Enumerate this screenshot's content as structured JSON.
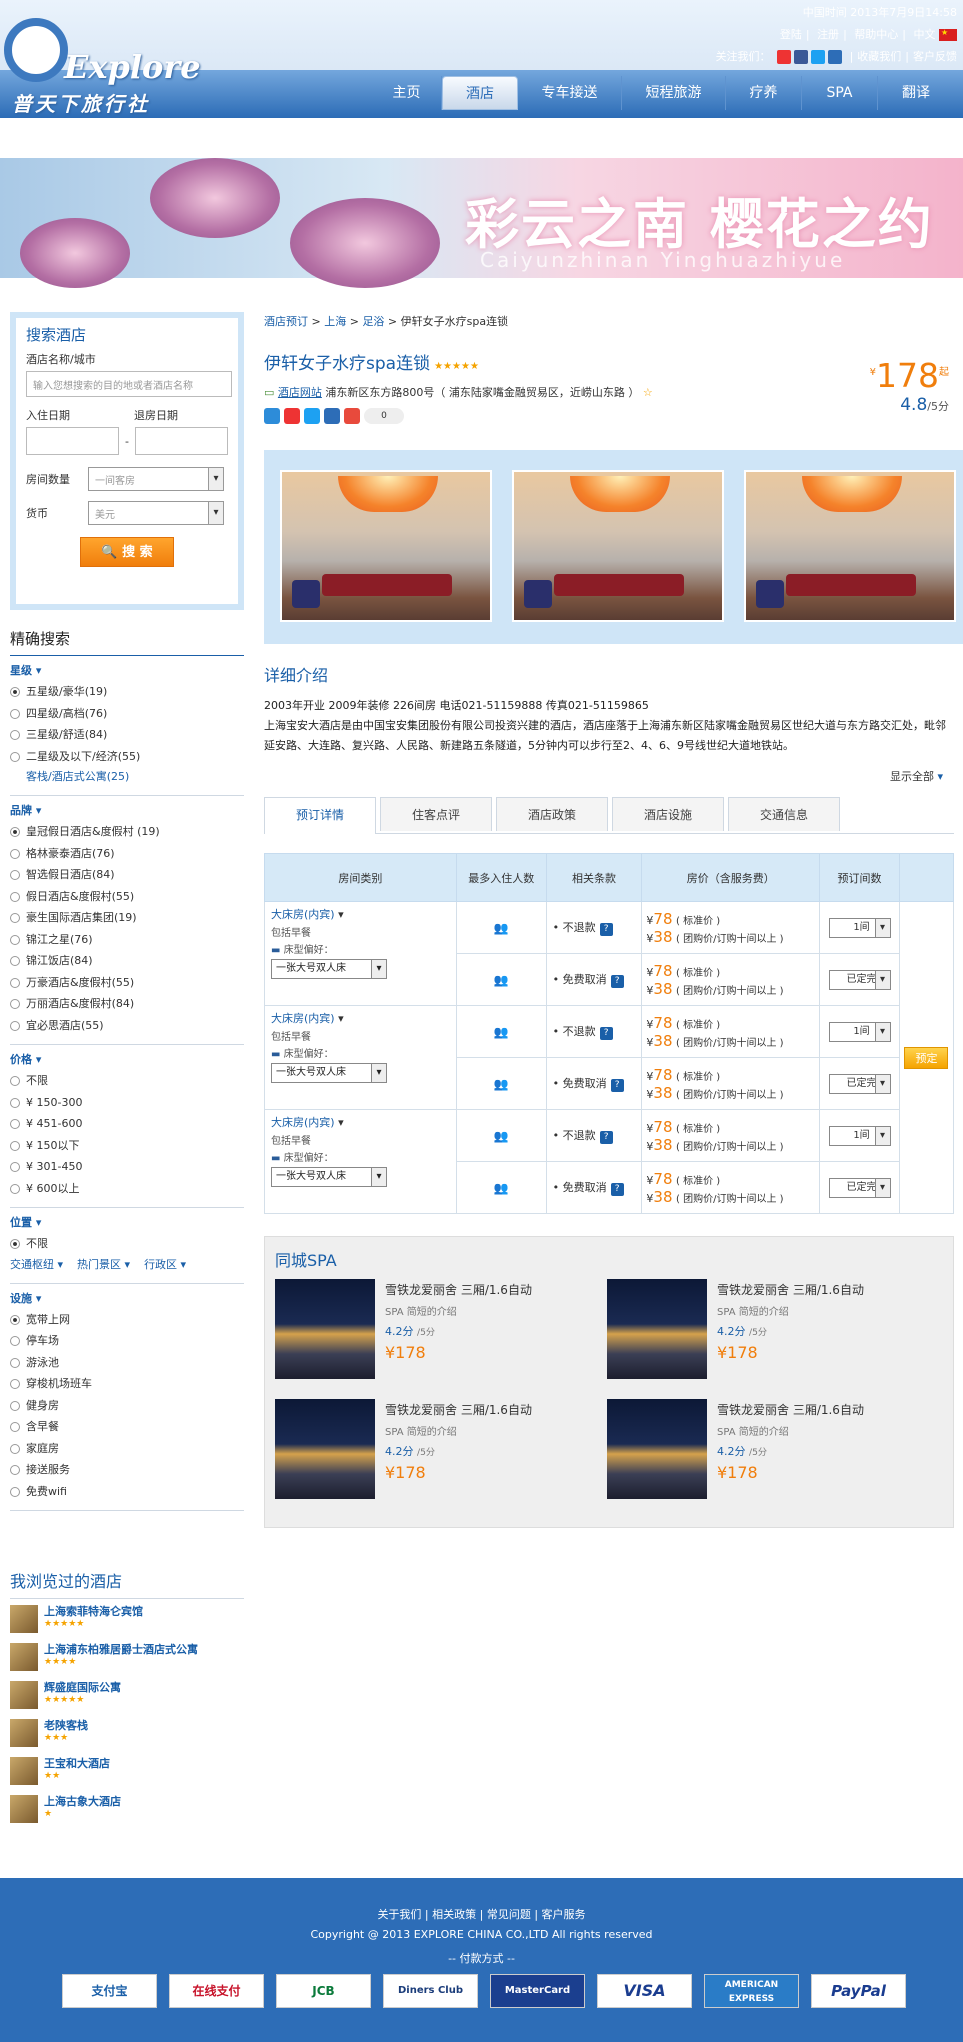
{
  "header": {
    "time_label": "中国时间",
    "time_value": "2013年7月9日14:58",
    "links": [
      "登陆",
      "注册",
      "帮助中心",
      "中文"
    ],
    "follow_label": "关注我们：",
    "fav": "收藏我们",
    "feedback": "客户反馈",
    "brand": "Explore",
    "brand_cn": "普天下旅行社",
    "nav": [
      "主页",
      "酒店",
      "专车接送",
      "短程旅游",
      "疗养",
      "SPA",
      "翻译"
    ],
    "nav_active": "酒店"
  },
  "banner": {
    "main": "彩云之南",
    "sub": "樱花之约",
    "pinyin": "Caiyunzhinan  Yinghuazhiyue"
  },
  "search": {
    "title": "搜索酒店",
    "name_label": "酒店名称/城市",
    "name_placeholder": "输入您想搜索的目的地或者酒店名称",
    "checkin_label": "入住日期",
    "checkout_label": "退房日期",
    "rooms_label": "房间数量",
    "rooms_value": "一间客房",
    "currency_label": "货币",
    "currency_value": "美元",
    "button": "搜 索"
  },
  "filters": {
    "title": "精确搜索",
    "star": {
      "title": "星级",
      "options": [
        "五星级/豪华(19)",
        "四星级/高档(76)",
        "三星级/舒适(84)",
        "二星级及以下/经济(55)"
      ],
      "link": "客栈/酒店式公寓(25)"
    },
    "brand": {
      "title": "品牌",
      "options": [
        "皇冠假日酒店&度假村 (19)",
        "格林豪泰酒店(76)",
        "智选假日酒店(84)",
        "假日酒店&度假村(55)",
        "豪生国际酒店集团(19)",
        "锦江之星(76)",
        "锦江饭店(84)",
        "万豪酒店&度假村(55)",
        "万丽酒店&度假村(84)",
        "宜必思酒店(55)"
      ]
    },
    "price": {
      "title": "价格",
      "options": [
        "不限",
        "¥ 150-300",
        "¥ 451-600",
        "¥ 150以下",
        "¥ 301-450",
        "¥ 600以上"
      ]
    },
    "location": {
      "title": "位置",
      "options": [
        "不限"
      ],
      "links": [
        "交通枢纽",
        "热门景区",
        "行政区"
      ]
    },
    "facility": {
      "title": "设施",
      "options": [
        "宽带上网",
        "停车场",
        "游泳池",
        "穿梭机场班车",
        "健身房",
        "含早餐",
        "家庭房",
        "接送服务",
        "免费wifi"
      ]
    }
  },
  "viewed": {
    "title": "我浏览过的酒店",
    "items": [
      {
        "name": "上海索菲特海仑宾馆",
        "stars": "★★★★★"
      },
      {
        "name": "上海浦东柏雅居爵士酒店式公寓",
        "stars": "★★★★"
      },
      {
        "name": "辉盛庭国际公寓",
        "stars": "★★★★★"
      },
      {
        "name": "老陕客栈",
        "stars": "★★★"
      },
      {
        "name": "王宝和大酒店",
        "stars": "★★"
      },
      {
        "name": "上海古象大酒店",
        "stars": "★"
      }
    ]
  },
  "breadcrumb": [
    "酒店预订",
    "上海",
    "足浴",
    "伊轩女子水疗spa连锁"
  ],
  "hotel": {
    "name": "伊轩女子水疗spa连锁",
    "stars": "★★★★★",
    "site": "酒店网站",
    "address": "浦东新区东方路800号（ 浦东陆家嘴金融贸易区，近崂山东路 ）",
    "share_count": "0",
    "price": "178",
    "price_unit": "起",
    "currency": "¥",
    "score": "4.8",
    "score_unit": "/5分"
  },
  "detail": {
    "title": "详细介绍",
    "line1": "2003年开业 2009年装修 226间房 电话021-51159888 传真021-51159865",
    "line2": "上海宝安大酒店是由中国宝安集团股份有限公司投资兴建的酒店，酒店座落于上海浦东新区陆家嘴金融贸易区世纪大道与东方路交汇处，毗邻延安路、大连路、复兴路、人民路、新建路五条隧道，5分钟内可以步行至2、4、6、9号线世纪大道地铁站。",
    "showall": "显示全部"
  },
  "tabs": [
    "预订详情",
    "住客点评",
    "酒店政策",
    "酒店设施",
    "交通信息"
  ],
  "table": {
    "headers": [
      "房间类别",
      "最多入住人数",
      "相关条款",
      "房价（含服务费）",
      "预订间数"
    ],
    "room": "大床房(内宾)",
    "breakfast": "包括早餐",
    "bed_label": "床型偏好：",
    "bed_value": "一张大号双人床",
    "term_a": "不退款",
    "term_b": "免费取消",
    "price_std": "78",
    "price_std_note": "( 标准价 )",
    "price_grp": "38",
    "price_grp_note": "( 团购价/订购十间以上 )",
    "qty_a": "1间",
    "qty_b": "已定完",
    "book": "预定"
  },
  "spa": {
    "title": "同城SPA",
    "cards": [
      {
        "name": "雪铁龙爱丽舍 三厢/1.6自动",
        "desc": "SPA 简短的介绍",
        "score": "4.2分",
        "unit": "/5分",
        "price": "¥178"
      },
      {
        "name": "雪铁龙爱丽舍 三厢/1.6自动",
        "desc": "SPA 简短的介绍",
        "score": "4.2分",
        "unit": "/5分",
        "price": "¥178"
      },
      {
        "name": "雪铁龙爱丽舍 三厢/1.6自动",
        "desc": "SPA 简短的介绍",
        "score": "4.2分",
        "unit": "/5分",
        "price": "¥178"
      },
      {
        "name": "雪铁龙爱丽舍 三厢/1.6自动",
        "desc": "SPA 简短的介绍",
        "score": "4.2分",
        "unit": "/5分",
        "price": "¥178"
      }
    ]
  },
  "footer": {
    "links": "关于我们 | 相关政策 | 常见问题 | 客户服务",
    "copyright": "Copyright @ 2013 EXPLORE CHINA CO.,LTD All rights reserved",
    "pay_title": "-- 付款方式 --",
    "pay": [
      "支付宝",
      "在线支付",
      "JCB",
      "Diners Club",
      "MasterCard",
      "VISA",
      "AMERICAN EXPRESS",
      "PayPal"
    ]
  }
}
